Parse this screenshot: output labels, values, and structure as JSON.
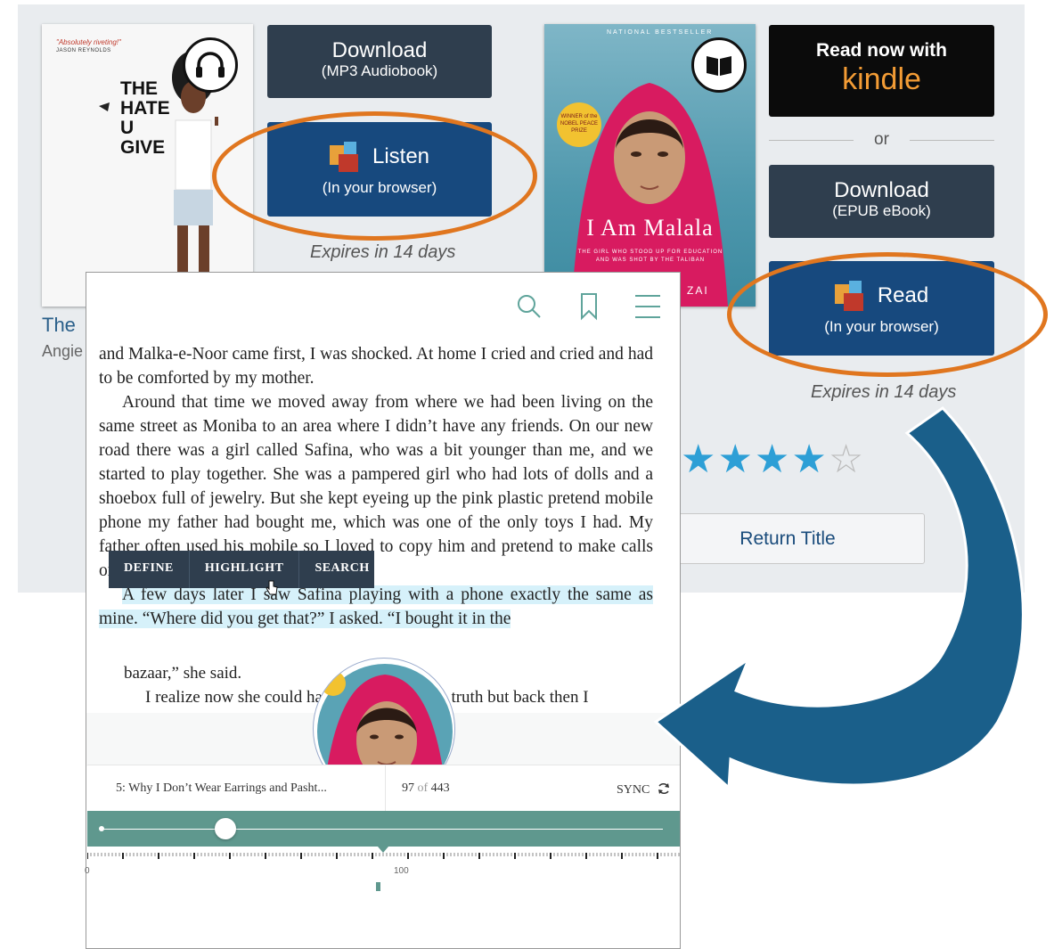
{
  "book1": {
    "cover": {
      "top_text": "\"Absolutely riveting!\"",
      "top_author": "JASON REYNOLDS",
      "title_lines": [
        "THE",
        "HATE",
        "U",
        "GIVE"
      ]
    },
    "format_icon": "headphones-icon",
    "title": "The",
    "author": "Angie",
    "download_label": "Download",
    "download_sub": "(MP3 Audiobook)",
    "listen_label": "Listen",
    "listen_sub": "(In your browser)",
    "expires": "Expires in 14 days"
  },
  "book2": {
    "cover": {
      "bestseller": "NATIONAL BESTSELLER",
      "badge": "WINNER of the NOBEL PEACE PRIZE",
      "title": "I Am Malala",
      "subtitle": "THE GIRL WHO STOOD UP FOR EDUCATION AND WAS SHOT BY THE TALIBAN",
      "author_fragment": "ZAI"
    },
    "format_icon": "book-icon",
    "kindle_label": "Read now with",
    "kindle_brand": "kindle",
    "or_label": "or",
    "download_label": "Download",
    "download_sub": "(EPUB eBook)",
    "read_label": "Read",
    "read_sub": "(In your browser)",
    "expires": "Expires in 14 days",
    "rating": 4,
    "rating_max": 5,
    "return_label": "Return Title"
  },
  "reader": {
    "header_icons": [
      "search-icon",
      "bookmark-icon",
      "menu-icon"
    ],
    "para1": "and Malka-e-Noor came first, I was shocked. At home I cried and cried and had to be comforted by my mother.",
    "para2": "Around that time we moved away from where we had been living on the same street as Moniba to an area where I didn’t have any friends. On our new road there was a girl called Safina, who was a bit younger than me, and we started to play together. She was a pampered girl who had lots of dolls and a shoebox full of jewelry. But she kept eyeing up the pink plastic pretend mobile phone my father had bought me, which was one of the only toys I had. My father often used his mobile so I loved to copy him and pretend to make calls on mine. One day it disappeared.",
    "para3_highlight": "A few days later I saw Safina playing with a phone exactly the same as mine. “Where did you get that?” I asked. “I bought it in the",
    "para4": "bazaar,” she said.",
    "para5": "I realize now she could have been telling the truth but back then I",
    "toolbar": {
      "define": "DEFINE",
      "highlight": "HIGHLIGHT",
      "search": "SEARCH"
    },
    "chapter": "5: Why I Don’t Wear Earrings and Pasht...",
    "page_current": "97",
    "page_of": "of",
    "page_total": "443",
    "sync_label": "SYNC",
    "progress": 0.22,
    "ruler_label_0": "0",
    "ruler_label_100": "100"
  },
  "colors": {
    "dark_button": "#2f3e4e",
    "blue_button": "#17497e",
    "orange_ring": "#e0761f",
    "arrow": "#1a5f8a",
    "highlight": "#d6f1fa",
    "slider": "#5f988e",
    "kindle_orange": "#f39c35"
  }
}
